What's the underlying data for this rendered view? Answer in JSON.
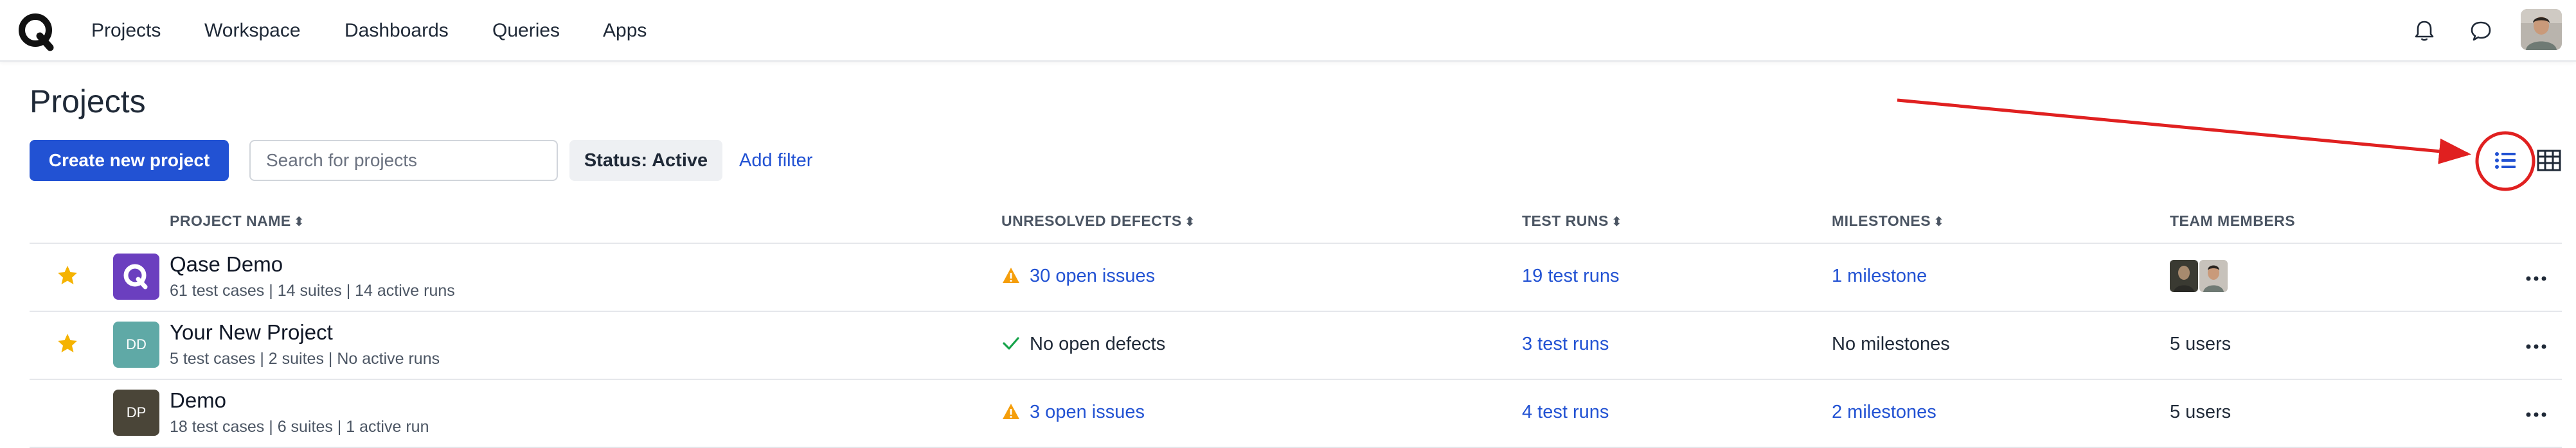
{
  "nav": {
    "items": [
      "Projects",
      "Workspace",
      "Dashboards",
      "Queries",
      "Apps"
    ]
  },
  "page": {
    "title": "Projects"
  },
  "toolbar": {
    "create_label": "Create new project",
    "search_placeholder": "Search for projects",
    "status_filter": "Status: Active",
    "add_filter": "Add filter"
  },
  "table": {
    "headers": {
      "project_name": "PROJECT NAME",
      "unresolved_defects": "UNRESOLVED DEFECTS",
      "test_runs": "TEST RUNS",
      "milestones": "MILESTONES",
      "team_members": "TEAM MEMBERS"
    },
    "rows": [
      {
        "starred": true,
        "avatar_text": "",
        "avatar_icon": "qase-logo-icon",
        "avatar_color": "#6b3fbf",
        "name": "Qase Demo",
        "meta": "61 test cases | 14 suites | 14 active runs",
        "defects": "30 open issues",
        "defects_status": "warning",
        "test_runs": "19 test runs",
        "milestones": "1 milestone",
        "milestones_link": true,
        "members": "",
        "members_avatars": 2
      },
      {
        "starred": true,
        "avatar_text": "DD",
        "avatar_color": "#5fa9a6",
        "name": "Your New Project",
        "meta": "5 test cases | 2 suites | No active runs",
        "defects": "No open defects",
        "defects_status": "ok",
        "test_runs": "3 test runs",
        "milestones": "No milestones",
        "milestones_link": false,
        "members": "5 users"
      },
      {
        "starred": false,
        "avatar_text": "DP",
        "avatar_color": "#4a4538",
        "name": "Demo",
        "meta": "18 test cases | 6 suites | 1 active run",
        "defects": "3 open issues",
        "defects_status": "warning",
        "test_runs": "4 test runs",
        "milestones": "2 milestones",
        "milestones_link": true,
        "members": "5 users"
      }
    ]
  },
  "colors": {
    "primary": "#2252d3",
    "warning": "#f59e0b",
    "success": "#16a34a",
    "star": "#f5b301",
    "annotation": "#e02020"
  }
}
